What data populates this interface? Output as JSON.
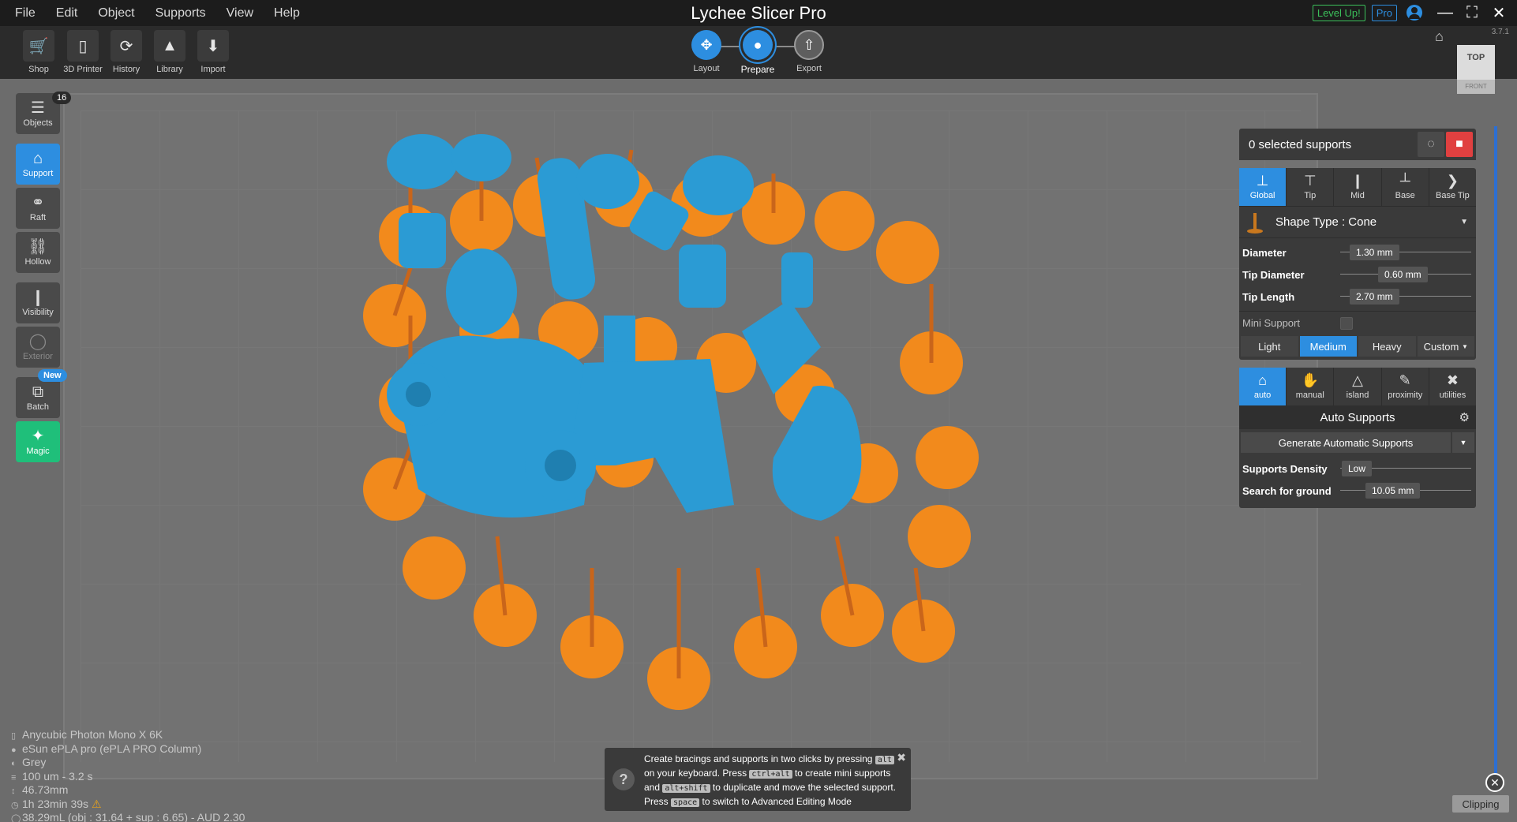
{
  "app": {
    "title": "Lychee Slicer Pro",
    "version": "3.7.1"
  },
  "menu": [
    "File",
    "Edit",
    "Object",
    "Supports",
    "View",
    "Help"
  ],
  "title_right": {
    "level_up": "Level Up!",
    "pro": "Pro"
  },
  "toolbar": [
    {
      "label": "Shop",
      "icon": "cart-icon"
    },
    {
      "label": "3D Printer",
      "icon": "printer-icon"
    },
    {
      "label": "History",
      "icon": "history-icon"
    },
    {
      "label": "Library",
      "icon": "library-icon"
    },
    {
      "label": "Import",
      "icon": "import-icon"
    }
  ],
  "steps": [
    {
      "label": "Layout",
      "state": "done"
    },
    {
      "label": "Prepare",
      "state": "active"
    },
    {
      "label": "Export",
      "state": "todo"
    }
  ],
  "left_panel": {
    "objects_label": "Objects",
    "objects_count": "16",
    "support_label": "Support",
    "raft_label": "Raft",
    "hollow_label": "Hollow",
    "visibility_label": "Visibility",
    "exterior_label": "Exterior",
    "batch_label": "Batch",
    "batch_badge": "New",
    "magic_label": "Magic"
  },
  "right_panel": {
    "selected_supports": "0 selected supports",
    "mode_tabs": [
      "Global",
      "Tip",
      "Mid",
      "Base",
      "Base Tip"
    ],
    "shape_type": "Shape Type : Cone",
    "params": [
      {
        "label": "Diameter",
        "value": "1.30 mm",
        "position": 0.35
      },
      {
        "label": "Tip Diameter",
        "value": "0.60 mm",
        "position": 0.52
      },
      {
        "label": "Tip Length",
        "value": "2.70 mm",
        "position": 0.38
      }
    ],
    "mini_support_label": "Mini Support",
    "density": [
      "Light",
      "Medium",
      "Heavy",
      "Custom"
    ],
    "density_active": "Medium",
    "tool_tabs": [
      "auto",
      "manual",
      "island",
      "proximity",
      "utilities"
    ],
    "auto_title": "Auto Supports",
    "generate_label": "Generate Automatic Supports",
    "auto_params": [
      {
        "label": "Supports Density",
        "value": "Low",
        "position": 0.0
      },
      {
        "label": "Search for ground",
        "value": "10.05 mm",
        "position": 0.45
      }
    ]
  },
  "view_cube": {
    "top": "TOP",
    "front": "FRONT"
  },
  "clipping_label": "Clipping",
  "info": {
    "printer": "Anycubic Photon Mono X 6K",
    "resin": "eSun ePLA pro (ePLA PRO Column)",
    "color": "Grey",
    "layer": "100 um - 3.2 s",
    "height": "46.73mm",
    "time": "1h 23min 39s",
    "volume": "38.29mL (obj : 31.64 + sup : 6.65) - AUD 2.30"
  },
  "tip": {
    "line1_a": "Create bracings and supports in two clicks by pressing",
    "key1": "alt",
    "line2_a": "on your keyboard. Press",
    "key2": "ctrl+alt",
    "line2_b": "to create mini supports",
    "line3_a": "and",
    "key3": "alt+shift",
    "line3_b": "to duplicate and move the selected support.",
    "line4_a": "Press",
    "key4": "space",
    "line4_b": "to switch to Advanced Editing Mode"
  },
  "colors": {
    "accent": "#2d8ee0",
    "support": "#f28a1c",
    "model": "#2b9bd4",
    "magic": "#1fbf7a"
  }
}
